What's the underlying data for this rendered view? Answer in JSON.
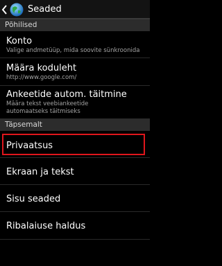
{
  "app": {
    "title": "Seaded",
    "back_icon": "chevron-left-icon",
    "app_icon": "globe-icon"
  },
  "colors": {
    "background": "#000000",
    "section_header_bg": "#2c2c2c",
    "highlight": "#e0161c",
    "subtitle_text": "#a3a3a3"
  },
  "sections": [
    {
      "header": "Põhilised",
      "items": [
        {
          "title": "Konto",
          "subtitle": "Valige andmetüüp, mida soovite sünkroonida"
        },
        {
          "title": "Määra koduleht",
          "subtitle": "http://www.google.com/"
        },
        {
          "title": "Ankeetide autom. täitmine",
          "subtitle": "Määra tekst veebiankeetide automaatseks täitmiseks"
        }
      ]
    },
    {
      "header": "Täpsemalt",
      "items": [
        {
          "title": "Privaatsus"
        },
        {
          "title": "Ekraan ja tekst"
        },
        {
          "title": "Sisu seaded"
        },
        {
          "title": "Ribalaiuse haldus"
        }
      ]
    }
  ]
}
